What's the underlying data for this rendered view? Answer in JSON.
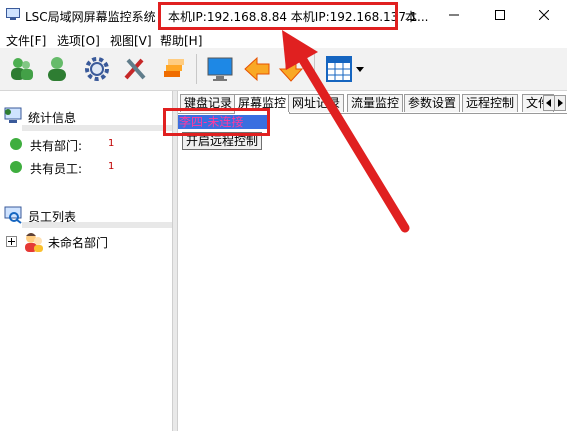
{
  "window": {
    "title": "LSC局域网屏幕监控系统",
    "ip_info": "本机IP:192.168.8.84  本机IP:192.168.137.1",
    "title_more": "本..."
  },
  "menu": [
    {
      "label": "文件[F]"
    },
    {
      "label": "选项[O]"
    },
    {
      "label": "视图[V]"
    },
    {
      "label": "帮助[H]"
    }
  ],
  "toolbar": {
    "icons": [
      "users-green-icon",
      "user-green-icon",
      "gear-icon",
      "tools-icon",
      "stack-icon",
      "monitor-icon",
      "arrow-left-icon",
      "arrow-down-icon",
      "calendar-grid-icon",
      "dropdown-icon"
    ]
  },
  "left": {
    "stats_title": "统计信息",
    "departments_label": "共有部门:",
    "departments_value": "1",
    "employees_label": "共有员工:",
    "employees_value": "1",
    "employee_list_title": "员工列表",
    "tree_root_label": "未命名部门"
  },
  "tabs": [
    {
      "label": "键盘记录"
    },
    {
      "label": "屏幕监控"
    },
    {
      "label": "网址记录"
    },
    {
      "label": "流量监控"
    },
    {
      "label": "参数设置"
    },
    {
      "label": "远程控制"
    },
    {
      "label": "文件"
    }
  ],
  "content": {
    "user_status": "李四-未连接",
    "remote_button": "开启远程控制"
  },
  "colors": {
    "highlight": "#e02020",
    "status_green": "#3fae3f",
    "count_red": "#c00000"
  }
}
